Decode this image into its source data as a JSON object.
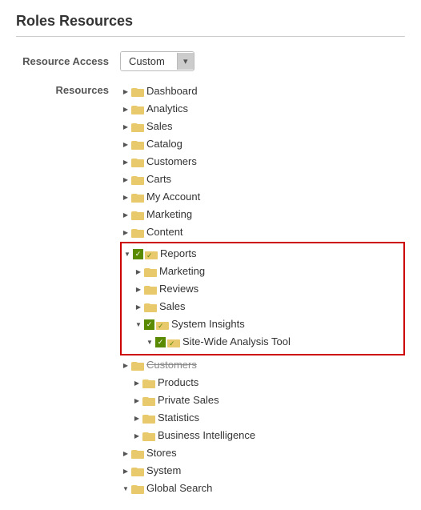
{
  "page": {
    "title": "Roles Resources"
  },
  "form": {
    "resource_access_label": "Resource Access",
    "resource_access_value": "Custom",
    "resources_label": "Resources"
  },
  "tree": {
    "items": [
      {
        "id": "dashboard",
        "label": "Dashboard",
        "level": 0,
        "toggle": "collapsed",
        "checkbox": false,
        "folder": "plain"
      },
      {
        "id": "analytics",
        "label": "Analytics",
        "level": 0,
        "toggle": "collapsed",
        "checkbox": false,
        "folder": "plain"
      },
      {
        "id": "sales",
        "label": "Sales",
        "level": 0,
        "toggle": "collapsed",
        "checkbox": false,
        "folder": "plain"
      },
      {
        "id": "catalog",
        "label": "Catalog",
        "level": 0,
        "toggle": "collapsed",
        "checkbox": false,
        "folder": "plain"
      },
      {
        "id": "customers",
        "label": "Customers",
        "level": 0,
        "toggle": "collapsed",
        "checkbox": false,
        "folder": "plain"
      },
      {
        "id": "carts",
        "label": "Carts",
        "level": 0,
        "toggle": "collapsed",
        "checkbox": false,
        "folder": "plain"
      },
      {
        "id": "my-account",
        "label": "My Account",
        "level": 0,
        "toggle": "collapsed",
        "checkbox": false,
        "folder": "plain"
      },
      {
        "id": "marketing",
        "label": "Marketing",
        "level": 0,
        "toggle": "collapsed",
        "checkbox": false,
        "folder": "plain"
      },
      {
        "id": "content",
        "label": "Content",
        "level": 0,
        "toggle": "collapsed",
        "checkbox": false,
        "folder": "plain"
      }
    ],
    "highlighted_group": {
      "root": {
        "id": "reports",
        "label": "Reports",
        "level": 0,
        "toggle": "expanded",
        "checkbox": true,
        "folder": "checked"
      },
      "children": [
        {
          "id": "marketing-sub",
          "label": "Marketing",
          "level": 1,
          "toggle": "collapsed",
          "checkbox": false,
          "folder": "plain"
        },
        {
          "id": "reviews",
          "label": "Reviews",
          "level": 1,
          "toggle": "collapsed",
          "checkbox": false,
          "folder": "plain"
        },
        {
          "id": "sales-sub",
          "label": "Sales",
          "level": 1,
          "toggle": "collapsed",
          "checkbox": false,
          "folder": "plain"
        },
        {
          "id": "system-insights",
          "label": "System Insights",
          "level": 1,
          "toggle": "expanded",
          "checkbox": true,
          "folder": "checked",
          "children": [
            {
              "id": "site-wide",
              "label": "Site-Wide Analysis Tool",
              "level": 2,
              "toggle": "none",
              "checkbox": true,
              "folder": "checked"
            }
          ]
        }
      ]
    },
    "after_items": [
      {
        "id": "customers-strike",
        "label": "Customers",
        "level": 0,
        "toggle": "collapsed",
        "checkbox": false,
        "folder": "plain",
        "strikethrough": true
      },
      {
        "id": "products",
        "label": "Products",
        "level": 1,
        "toggle": "collapsed",
        "checkbox": false,
        "folder": "plain"
      },
      {
        "id": "private-sales",
        "label": "Private Sales",
        "level": 1,
        "toggle": "collapsed",
        "checkbox": false,
        "folder": "plain"
      },
      {
        "id": "statistics",
        "label": "Statistics",
        "level": 1,
        "toggle": "collapsed",
        "checkbox": false,
        "folder": "plain"
      },
      {
        "id": "business-intelligence",
        "label": "Business Intelligence",
        "level": 1,
        "toggle": "collapsed",
        "checkbox": false,
        "folder": "plain"
      },
      {
        "id": "stores",
        "label": "Stores",
        "level": 0,
        "toggle": "collapsed",
        "checkbox": false,
        "folder": "plain"
      },
      {
        "id": "system",
        "label": "System",
        "level": 0,
        "toggle": "collapsed",
        "checkbox": false,
        "folder": "plain"
      },
      {
        "id": "global-search",
        "label": "Global Search",
        "level": 0,
        "toggle": "expanded",
        "checkbox": false,
        "folder": "plain"
      }
    ]
  }
}
